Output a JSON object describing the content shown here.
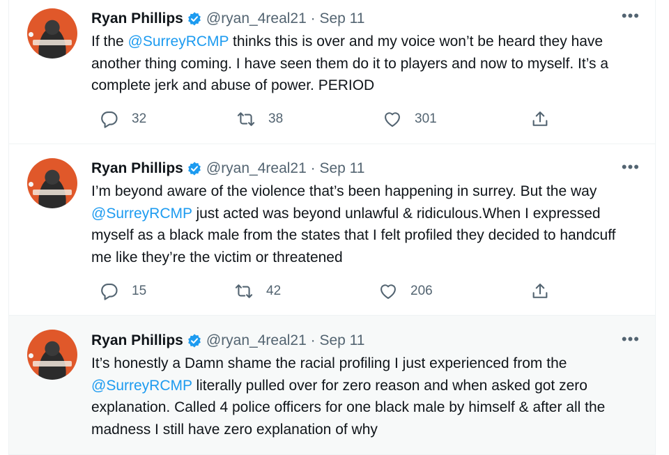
{
  "colors": {
    "accent": "#1d9bf0",
    "secondary_text": "#536471",
    "primary_text": "#0f1419",
    "avatar_bg": "#e0582a"
  },
  "tweets": [
    {
      "name": "Ryan Phillips",
      "handle": "@ryan_4real21",
      "date": "Sep 11",
      "more_icon": "more-horizontal-icon",
      "text": [
        {
          "t": "If the ",
          "m": false
        },
        {
          "t": "@SurreyRCMP",
          "m": true
        },
        {
          "t": " thinks this is over and my voice won’t be heard they have another thing coming. I have seen them do it to players and now to myself. It’s a complete jerk and abuse of power. PERIOD",
          "m": false
        }
      ],
      "replies": "32",
      "retweets": "38",
      "likes": "301"
    },
    {
      "name": "Ryan Phillips",
      "handle": "@ryan_4real21",
      "date": "Sep 11",
      "more_icon": "more-horizontal-icon",
      "text": [
        {
          "t": "I’m beyond aware of the violence that’s been happening in surrey. But the way ",
          "m": false
        },
        {
          "t": "@SurreyRCMP",
          "m": true
        },
        {
          "t": " just acted was beyond unlawful & ridiculous.When I expressed myself as a black male from the states that I felt profiled they decided to handcuff me like they’re the victim or threatened",
          "m": false
        }
      ],
      "replies": "15",
      "retweets": "42",
      "likes": "206"
    },
    {
      "name": "Ryan Phillips",
      "handle": "@ryan_4real21",
      "date": "Sep 11",
      "more_icon": "more-horizontal-icon",
      "text": [
        {
          "t": "It’s honestly a Damn shame the racial profiling I just experienced from the ",
          "m": false
        },
        {
          "t": "@SurreyRCMP",
          "m": true
        },
        {
          "t": " literally pulled over for zero reason and when asked got zero explanation. Called 4 police officers for one black male by himself & after all the madness I still have zero explanation of why",
          "m": false
        }
      ]
    }
  ]
}
